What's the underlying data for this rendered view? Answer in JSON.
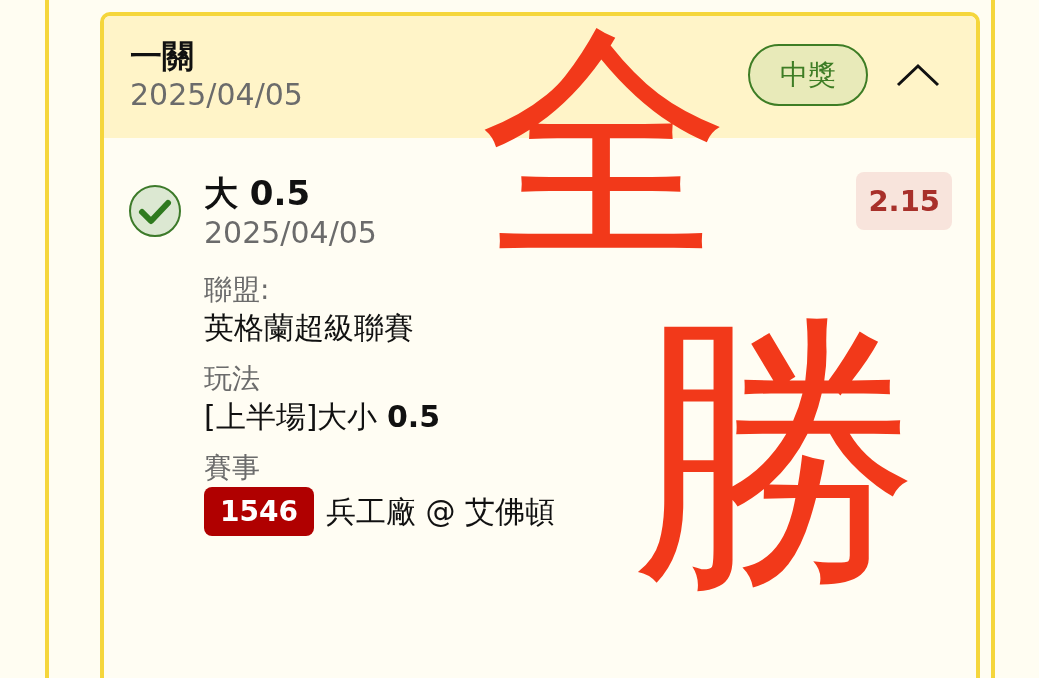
{
  "card": {
    "title": "一關",
    "date": "2025/04/05",
    "status": "中獎",
    "expanded": true,
    "selection": {
      "checked": true,
      "name": "大 0.5",
      "date": "2025/04/05",
      "odds": "2.15",
      "fields": [
        {
          "label": "聯盟:",
          "value": "英格蘭超級聯賽"
        },
        {
          "label": "玩法",
          "value": "[上半場]大小 **0.5**"
        },
        {
          "label": "賽事",
          "match_id": "1546",
          "value": "兵工廠 @ 艾佛頓"
        }
      ]
    }
  },
  "annotation": {
    "text": "全勝"
  }
}
